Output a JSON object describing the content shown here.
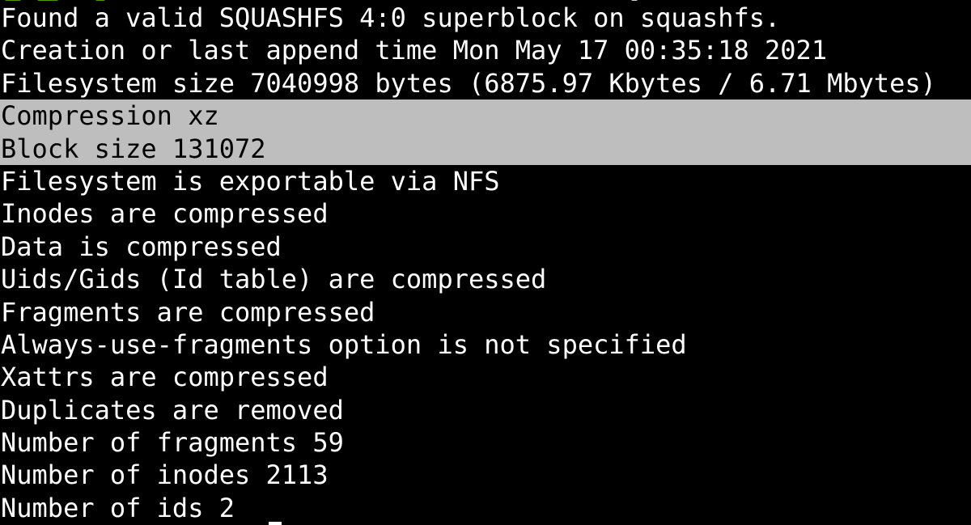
{
  "terminal": {
    "lines": [
      {
        "text": "Found a valid SQUASHFS 4:0 superblock on squashfs.",
        "selected": false
      },
      {
        "text": "Creation or last append time Mon May 17 00:35:18 2021",
        "selected": false
      },
      {
        "text": "Filesystem size 7040998 bytes (6875.97 Kbytes / 6.71 Mbytes)",
        "selected": false
      },
      {
        "text": "Compression xz",
        "selected": true
      },
      {
        "text": "Block size 131072",
        "selected": true
      },
      {
        "text": "Filesystem is exportable via NFS",
        "selected": false
      },
      {
        "text": "Inodes are compressed",
        "selected": false
      },
      {
        "text": "Data is compressed",
        "selected": false
      },
      {
        "text": "Uids/Gids (Id table) are compressed",
        "selected": false
      },
      {
        "text": "Fragments are compressed",
        "selected": false
      },
      {
        "text": "Always-use-fragments option is not specified",
        "selected": false
      },
      {
        "text": "Xattrs are compressed",
        "selected": false
      },
      {
        "text": "Duplicates are removed",
        "selected": false
      },
      {
        "text": "Number of fragments 59",
        "selected": false
      },
      {
        "text": "Number of inodes 2113",
        "selected": false
      },
      {
        "text": "Number of ids 2",
        "selected": false
      }
    ],
    "colors": {
      "background": "#000000",
      "foreground": "#ffffff",
      "selection_background": "#bebebe",
      "selection_foreground": "#000000",
      "prompt_green": "#4e9a06"
    }
  }
}
